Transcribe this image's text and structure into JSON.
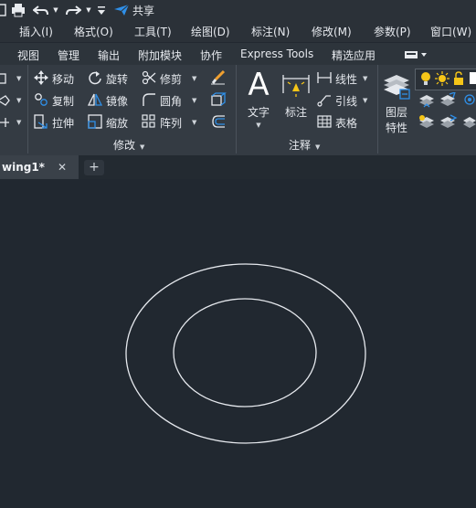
{
  "quick_access": {
    "share_label": "共享",
    "icons": [
      "document-icon",
      "print-icon",
      "undo-icon",
      "redo-icon",
      "customize-icon",
      "share-icon"
    ]
  },
  "menu": [
    "插入(I)",
    "格式(O)",
    "工具(T)",
    "绘图(D)",
    "标注(N)",
    "修改(M)",
    "参数(P)",
    "窗口(W)"
  ],
  "ribbon_tabs": [
    "视图",
    "管理",
    "输出",
    "附加模块",
    "协作",
    "Express Tools",
    "精选应用"
  ],
  "modify_panel": {
    "title": "修改",
    "col1": [
      "移动",
      "复制",
      "拉伸"
    ],
    "col2": [
      "旋转",
      "镜像",
      "缩放"
    ],
    "col3": [
      "修剪",
      "圆角",
      "阵列"
    ]
  },
  "annotation_panel": {
    "title": "注释",
    "text_label": "文字",
    "dimension_label": "标注",
    "linear_label": "线性",
    "leader_label": "引线",
    "table_label": "表格"
  },
  "layers_panel": {
    "label_line1": "图层",
    "label_line2": "特性"
  },
  "document_tab": {
    "name": "wing1*",
    "close_symbol": "✕",
    "new_tab_symbol": "+"
  },
  "colors": {
    "background": "#212830",
    "ribbon": "#343b43",
    "accent_blue": "#2f8fe8",
    "lightbulb_yellow": "#f5c518"
  }
}
